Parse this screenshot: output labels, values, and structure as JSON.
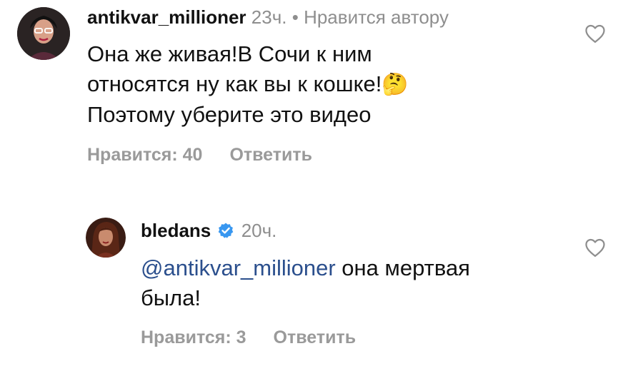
{
  "comments": [
    {
      "username": "antikvar_millioner",
      "time": "23ч.",
      "separator": "•",
      "liked_by_author": "Нравится автору",
      "lines": [
        "Она же живая!В Сочи к ним",
        "относятся ну как вы к кошке!",
        "Поэтому уберите это видео"
      ],
      "emoji": "🤔",
      "likes_label": "Нравится: 40",
      "reply_label": "Ответить"
    },
    {
      "username": "bledans",
      "verified": true,
      "time": "20ч.",
      "mention": "@antikvar_millioner",
      "line1_rest": " она мертвая",
      "line2": "была!",
      "likes_label": "Нравится: 3",
      "reply_label": "Ответить"
    }
  ],
  "colors": {
    "verified": "#3897f0",
    "mention": "#2b4f8d",
    "meta": "#8e8e8e"
  }
}
